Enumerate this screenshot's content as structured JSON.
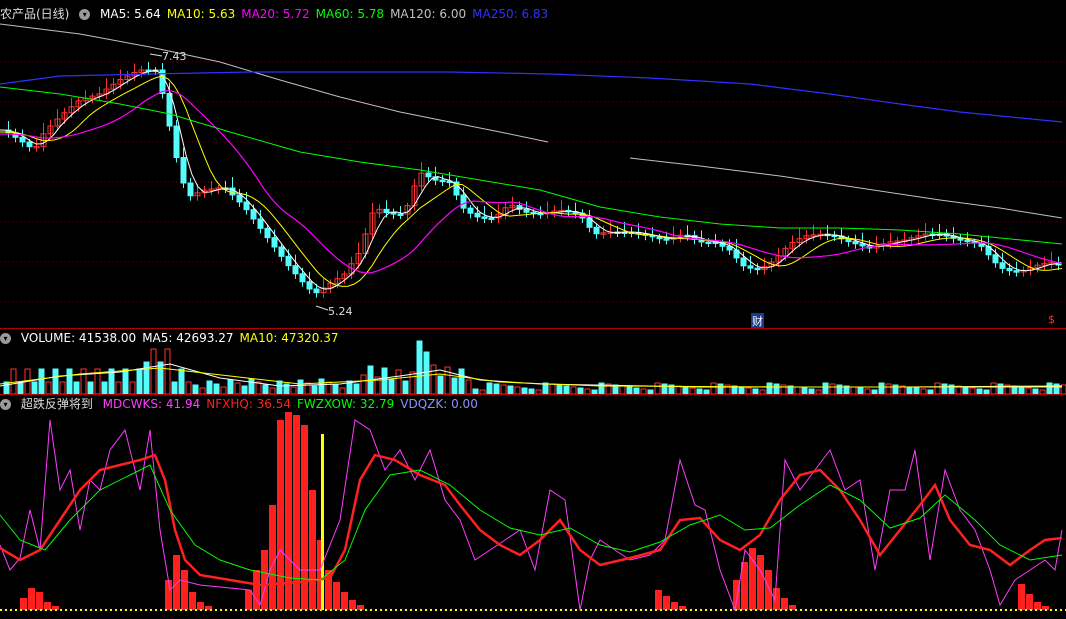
{
  "colors": {
    "up": "#ff3232",
    "down": "#54fcfc",
    "ma5": "#ffffff",
    "ma10": "#ffff00",
    "ma20": "#ff00ff",
    "ma60": "#00ff00",
    "ma120": "#c0c0c0",
    "ma250": "#3030ff",
    "mdcwks": "#ff3cff",
    "nfxhq": "#ff2020",
    "fwzxow": "#00ff00",
    "vdqzk": "#9090ff"
  },
  "main": {
    "title": "农产品(日线)",
    "indicators": [
      {
        "label": "MA5: 5.64",
        "color": "#ffffff"
      },
      {
        "label": "MA10: 5.63",
        "color": "#ffff00"
      },
      {
        "label": "MA20: 5.72",
        "color": "#ff00ff"
      },
      {
        "label": "MA60: 5.78",
        "color": "#00ff00"
      },
      {
        "label": "MA120: 6.00",
        "color": "#c0c0c0"
      },
      {
        "label": "MA250: 6.83",
        "color": "#3030ff"
      }
    ],
    "high_label": "7.43",
    "low_label": "5.24",
    "cai_label": "财",
    "dollar_label": "$"
  },
  "volume": {
    "indicators": [
      {
        "label": "VOLUME: 41538.00",
        "color": "#ffffff"
      },
      {
        "label": "MA5: 42693.27",
        "color": "#ffffff"
      },
      {
        "label": "MA10: 47320.37",
        "color": "#ffff00"
      }
    ]
  },
  "osc": {
    "title": "超跌反弹将到",
    "indicators": [
      {
        "label": "MDCWKS: 41.94",
        "color": "#ff3cff"
      },
      {
        "label": "NFXHQ: 36.54",
        "color": "#ff2020"
      },
      {
        "label": "FWZXOW: 32.79",
        "color": "#00ff00"
      },
      {
        "label": "VDQZK: 0.00",
        "color": "#9090ff"
      }
    ]
  }
}
